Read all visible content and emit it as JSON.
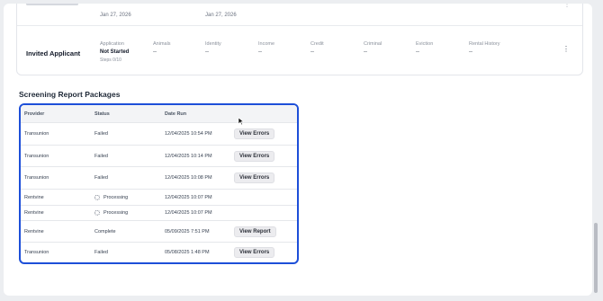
{
  "previous_applicant": {
    "dates": [
      "Jan 27, 2026",
      "Jan 27, 2026"
    ]
  },
  "applicant": {
    "name": "Invited Applicant",
    "columns": [
      {
        "header": "Application",
        "value": "Not Started",
        "sub": "Steps 0/10"
      },
      {
        "header": "Animals",
        "value": "--"
      },
      {
        "header": "Identity",
        "value": "--"
      },
      {
        "header": "Income",
        "value": "--"
      },
      {
        "header": "Credit",
        "value": "--"
      },
      {
        "header": "Criminal",
        "value": "--"
      },
      {
        "header": "Eviction",
        "value": "--"
      },
      {
        "header": "Rental History",
        "value": "--"
      }
    ],
    "menu_icon": "⋮"
  },
  "screening": {
    "title": "Screening Report Packages",
    "headers": {
      "provider": "Provider",
      "status": "Status",
      "date_run": "Date Run"
    },
    "rows": [
      {
        "provider": "Transunion",
        "status": "Failed",
        "date": "12/04/2025 10:54 PM",
        "action": "View Errors"
      },
      {
        "provider": "Transunion",
        "status": "Failed",
        "date": "12/04/2025 10:14 PM",
        "action": "View Errors"
      },
      {
        "provider": "Transunion",
        "status": "Failed",
        "date": "12/04/2025 10:08 PM",
        "action": "View Errors"
      },
      {
        "provider": "Rentvine",
        "status": "Processing",
        "date": "12/04/2025 10:07 PM",
        "action": ""
      },
      {
        "provider": "Rentvine",
        "status": "Processing",
        "date": "12/04/2025 10:07 PM",
        "action": ""
      },
      {
        "provider": "Rentvine",
        "status": "Complete",
        "date": "05/09/2025 7:51 PM",
        "action": "View Report"
      },
      {
        "provider": "Transunion",
        "status": "Failed",
        "date": "05/08/2025 1:48 PM",
        "action": "View Errors"
      }
    ]
  }
}
